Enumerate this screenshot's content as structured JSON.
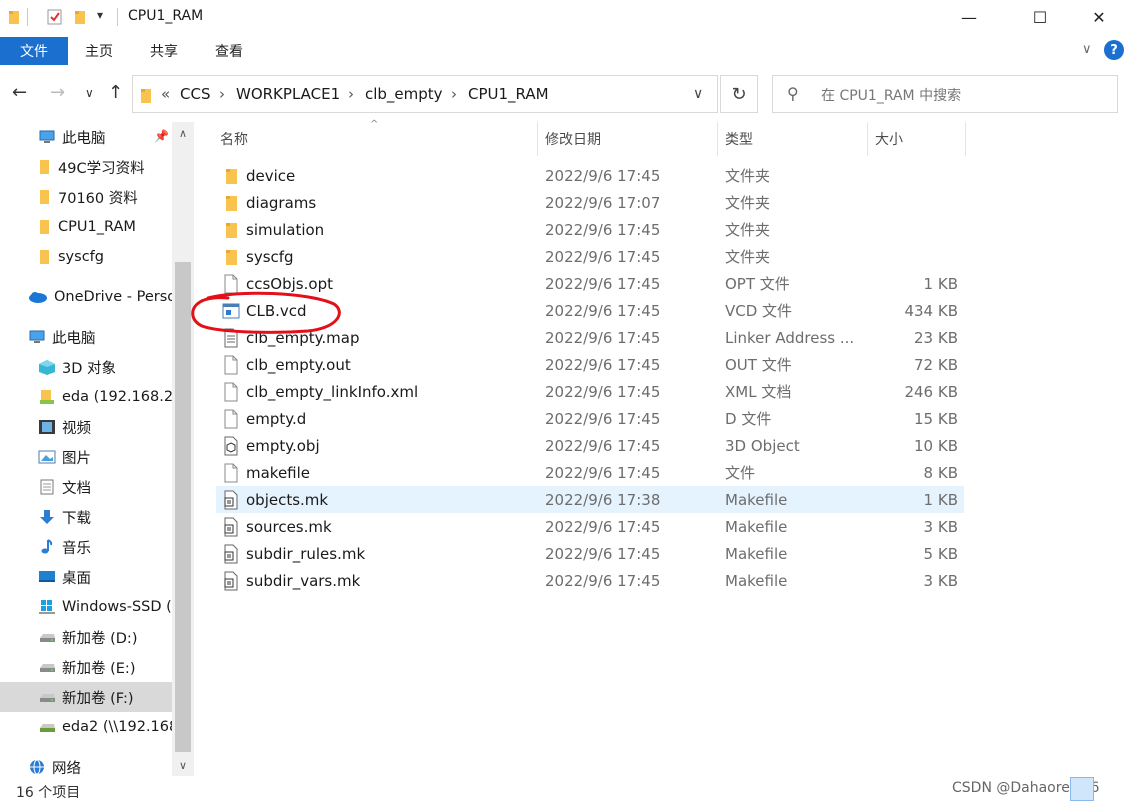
{
  "window": {
    "title": "CPU1_RAM",
    "quick_access_dropdown": "▾",
    "minimize": "—",
    "maximize": "☐",
    "close": "✕"
  },
  "ribbon": {
    "tabs": [
      {
        "label": "文件",
        "active": true
      },
      {
        "label": "主页"
      },
      {
        "label": "共享"
      },
      {
        "label": "查看"
      }
    ],
    "expand": "∨",
    "help": "?"
  },
  "nav": {
    "back": "←",
    "forward": "→",
    "recent": "∨",
    "up": "↑",
    "breadcrumb_overflow": "«",
    "breadcrumbs": [
      "CCS",
      "WORKPLACE1",
      "clb_empty",
      "CPU1_RAM"
    ],
    "separator": "›",
    "dropdown": "∨",
    "refresh": "↻",
    "search_placeholder": "在 CPU1_RAM 中搜索"
  },
  "sidebar": {
    "items": [
      {
        "label": "此电脑",
        "icon": "pc-icon",
        "pinned": true
      },
      {
        "label": "49C学习资料",
        "icon": "folder-icon"
      },
      {
        "label": "70160 资料",
        "icon": "folder-icon"
      },
      {
        "label": "CPU1_RAM",
        "icon": "folder-icon"
      },
      {
        "label": "syscfg",
        "icon": "folder-icon"
      },
      {
        "label": "OneDrive - Perso",
        "icon": "cloud-icon"
      },
      {
        "label": "此电脑",
        "icon": "pc-icon"
      },
      {
        "label": "3D 对象",
        "icon": "3d-objects-icon"
      },
      {
        "label": "eda (192.168.2.",
        "icon": "network-drive-icon"
      },
      {
        "label": "视频",
        "icon": "video-icon"
      },
      {
        "label": "图片",
        "icon": "pictures-icon"
      },
      {
        "label": "文档",
        "icon": "documents-icon"
      },
      {
        "label": "下载",
        "icon": "download-icon"
      },
      {
        "label": "音乐",
        "icon": "music-icon"
      },
      {
        "label": "桌面",
        "icon": "desktop-icon"
      },
      {
        "label": "Windows-SSD (",
        "icon": "windows-drive-icon"
      },
      {
        "label": "新加卷 (D:)",
        "icon": "drive-icon"
      },
      {
        "label": "新加卷 (E:)",
        "icon": "drive-icon"
      },
      {
        "label": "新加卷 (F:)",
        "icon": "drive-icon",
        "selected": true
      },
      {
        "label": "eda2 (\\\\192.168",
        "icon": "network-drive-icon"
      },
      {
        "label": "网络",
        "icon": "network-icon"
      }
    ],
    "scroll_up": "∧",
    "scroll_down": "∨"
  },
  "columns": {
    "name": "名称",
    "date": "修改日期",
    "type": "类型",
    "size": "大小",
    "sort_indicator": "^"
  },
  "files": [
    {
      "name": "device",
      "date": "2022/9/6 17:45",
      "type": "文件夹",
      "size": "",
      "icon": "folder-icon"
    },
    {
      "name": "diagrams",
      "date": "2022/9/6 17:07",
      "type": "文件夹",
      "size": "",
      "icon": "folder-icon"
    },
    {
      "name": "simulation",
      "date": "2022/9/6 17:45",
      "type": "文件夹",
      "size": "",
      "icon": "folder-icon"
    },
    {
      "name": "syscfg",
      "date": "2022/9/6 17:45",
      "type": "文件夹",
      "size": "",
      "icon": "folder-icon"
    },
    {
      "name": "ccsObjs.opt",
      "date": "2022/9/6 17:45",
      "type": "OPT 文件",
      "size": "1 KB",
      "icon": "file-icon"
    },
    {
      "name": "CLB.vcd",
      "date": "2022/9/6 17:45",
      "type": "VCD 文件",
      "size": "434 KB",
      "icon": "vcd-file-icon"
    },
    {
      "name": "clb_empty.map",
      "date": "2022/9/6 17:45",
      "type": "Linker Address ...",
      "size": "23 KB",
      "icon": "text-file-icon"
    },
    {
      "name": "clb_empty.out",
      "date": "2022/9/6 17:45",
      "type": "OUT 文件",
      "size": "72 KB",
      "icon": "file-icon"
    },
    {
      "name": "clb_empty_linkInfo.xml",
      "date": "2022/9/6 17:45",
      "type": "XML 文档",
      "size": "246 KB",
      "icon": "file-icon"
    },
    {
      "name": "empty.d",
      "date": "2022/9/6 17:45",
      "type": "D 文件",
      "size": "15 KB",
      "icon": "file-icon"
    },
    {
      "name": "empty.obj",
      "date": "2022/9/6 17:45",
      "type": "3D Object",
      "size": "10 KB",
      "icon": "3d-object-file-icon"
    },
    {
      "name": "makefile",
      "date": "2022/9/6 17:45",
      "type": "文件",
      "size": "8 KB",
      "icon": "file-icon"
    },
    {
      "name": "objects.mk",
      "date": "2022/9/6 17:38",
      "type": "Makefile",
      "size": "1 KB",
      "icon": "makefile-icon",
      "hover": true
    },
    {
      "name": "sources.mk",
      "date": "2022/9/6 17:45",
      "type": "Makefile",
      "size": "3 KB",
      "icon": "makefile-icon"
    },
    {
      "name": "subdir_rules.mk",
      "date": "2022/9/6 17:45",
      "type": "Makefile",
      "size": "5 KB",
      "icon": "makefile-icon"
    },
    {
      "name": "subdir_vars.mk",
      "date": "2022/9/6 17:45",
      "type": "Makefile",
      "size": "3 KB",
      "icon": "makefile-icon"
    }
  ],
  "status": {
    "item_count": "16 个项目"
  },
  "watermark": "CSDN @Dahaore.s66",
  "colors": {
    "accent": "#1a6fcf",
    "folder": "#f8c44f",
    "hover_row": "#e5f3ff",
    "selected_nav": "#d9d9d9",
    "annotation": "#e3101a"
  }
}
